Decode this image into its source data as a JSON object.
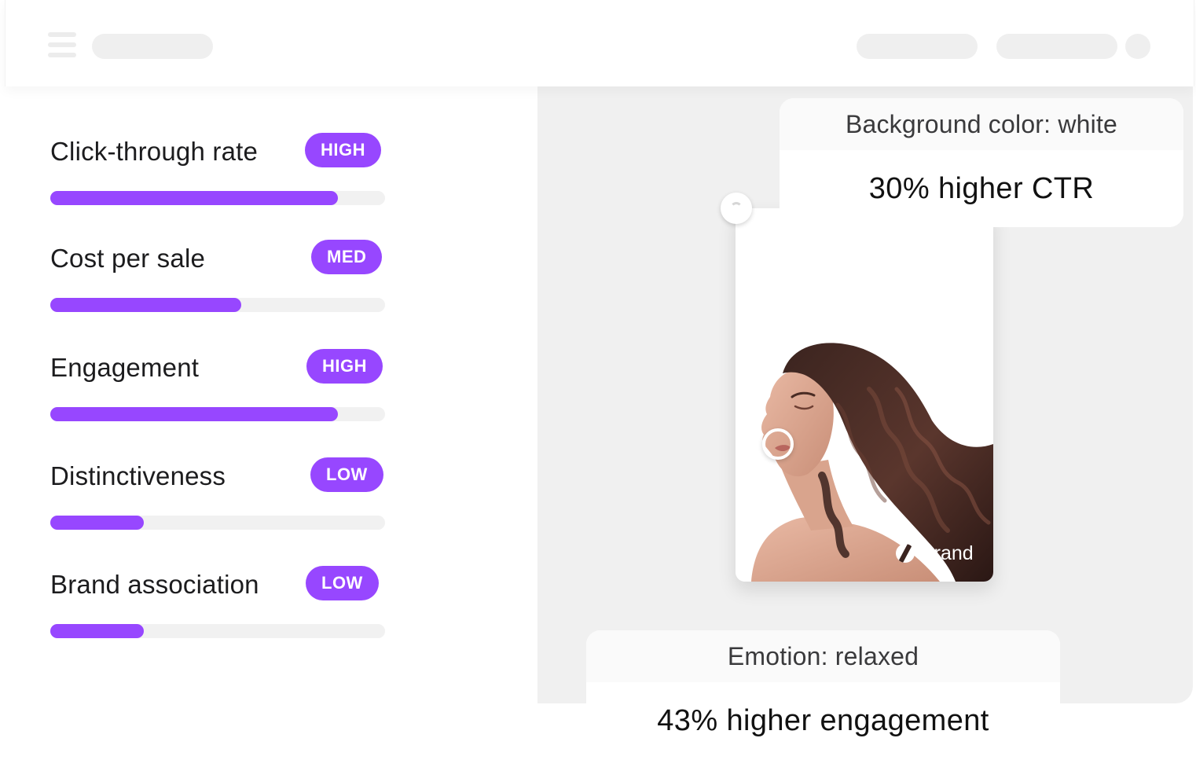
{
  "colors": {
    "accent": "#9747ff",
    "panel": "#f0f0f0",
    "track": "#f1f1f1",
    "skeleton": "#efefef"
  },
  "header": {
    "menu_icon": "hamburger-menu-icon",
    "placeholders": [
      "title-placeholder",
      "action-placeholder-1",
      "action-placeholder-2",
      "avatar-placeholder"
    ]
  },
  "metrics": [
    {
      "label": "Click-through rate",
      "level": "HIGH",
      "score": 0.86
    },
    {
      "label": "Cost per sale",
      "level": "MED",
      "score": 0.57
    },
    {
      "label": "Engagement",
      "level": "HIGH",
      "score": 0.86
    },
    {
      "label": "Distinctiveness",
      "level": "LOW",
      "score": 0.28
    },
    {
      "label": "Brand association",
      "level": "LOW",
      "score": 0.28
    }
  ],
  "insights": {
    "background": {
      "attribute": "Background color: white",
      "result": "30% higher CTR"
    },
    "emotion": {
      "attribute": "Emotion: relaxed",
      "result": "43% higher engagement"
    }
  },
  "ad": {
    "brand_label": "Brand",
    "brand_icon": "brand-logo-icon",
    "image": "woman-with-wavy-hair-photo"
  }
}
